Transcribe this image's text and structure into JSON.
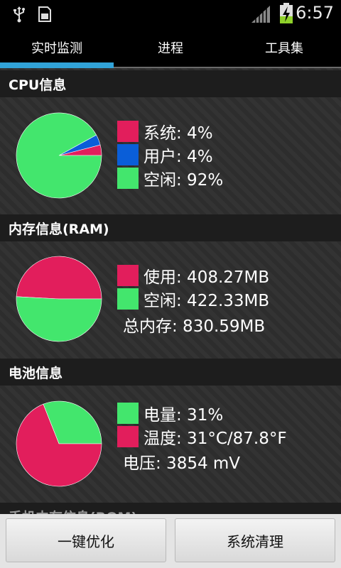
{
  "status_bar": {
    "time": "6:57",
    "icons": [
      "usb-icon",
      "sd-card-icon",
      "signal-icon",
      "battery-charging-icon"
    ]
  },
  "tabs": [
    {
      "label": "实时监测",
      "active": true
    },
    {
      "label": "进程",
      "active": false
    },
    {
      "label": "工具集",
      "active": false
    }
  ],
  "cpu": {
    "title": "CPU信息",
    "items": [
      {
        "label": "系统: 4%",
        "color": "#e21e5c",
        "value": 4
      },
      {
        "label": "用户: 4%",
        "color": "#0a5ed8",
        "value": 4
      },
      {
        "label": "空闲: 92%",
        "color": "#43e66d",
        "value": 92
      }
    ]
  },
  "ram": {
    "title": "内存信息(RAM)",
    "items": [
      {
        "label": "使用: 408.27MB",
        "color": "#e21e5c",
        "value": 408.27
      },
      {
        "label": "空闲: 422.33MB",
        "color": "#43e66d",
        "value": 422.33
      }
    ],
    "total": "总内存: 830.59MB"
  },
  "battery": {
    "title": "电池信息",
    "items": [
      {
        "label": "电量: 31%",
        "color": "#43e66d",
        "value": 31
      },
      {
        "label": "温度: 31°C/87.8°F",
        "color": "#e21e5c"
      }
    ],
    "voltage": "电压: 3854 mV"
  },
  "rom": {
    "title": "手机内存信息(ROM)"
  },
  "buttons": {
    "optimize": "一键优化",
    "clean": "系统清理"
  }
}
